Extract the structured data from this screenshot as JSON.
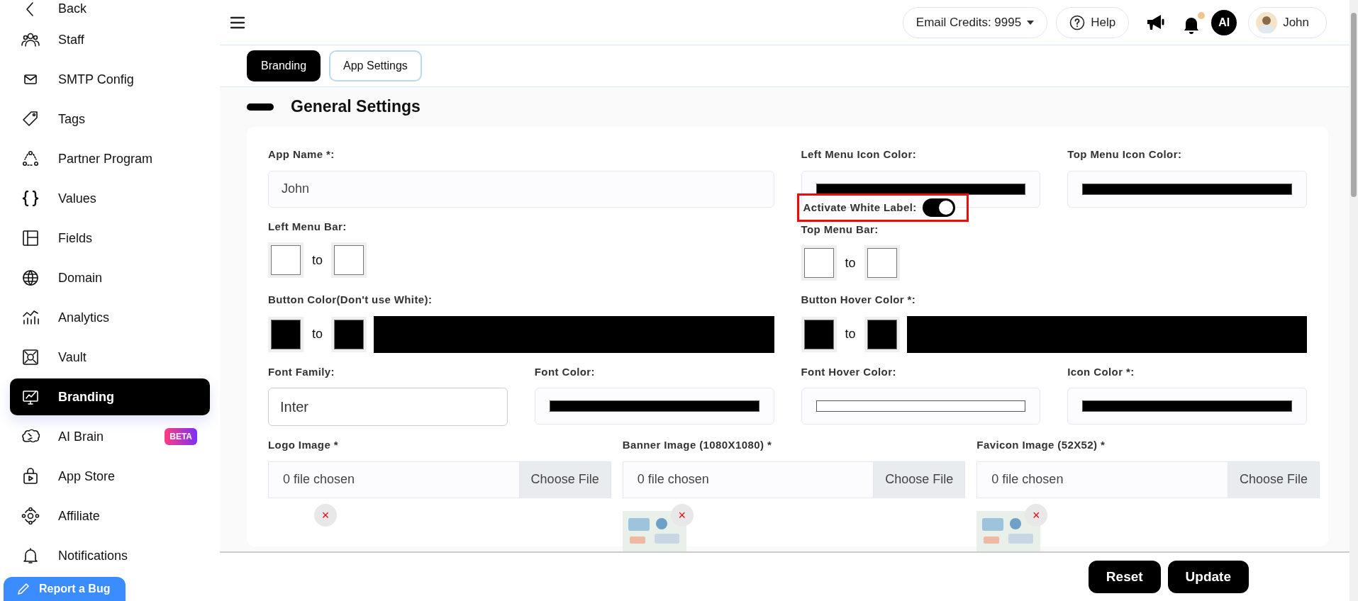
{
  "sidebar": {
    "items": [
      {
        "label": "Back",
        "selected": false
      },
      {
        "label": "Staff",
        "selected": false
      },
      {
        "label": "SMTP Config",
        "selected": false
      },
      {
        "label": "Tags",
        "selected": false
      },
      {
        "label": "Partner Program",
        "selected": false
      },
      {
        "label": "Values",
        "selected": false
      },
      {
        "label": "Fields",
        "selected": false
      },
      {
        "label": "Domain",
        "selected": false
      },
      {
        "label": "Analytics",
        "selected": false
      },
      {
        "label": "Vault",
        "selected": false
      },
      {
        "label": "Branding",
        "selected": true
      },
      {
        "label": "AI Brain",
        "selected": false,
        "badge": "BETA"
      },
      {
        "label": "App Store",
        "selected": false
      },
      {
        "label": "Affiliate",
        "selected": false
      },
      {
        "label": "Notifications",
        "selected": false
      }
    ],
    "report_button": "Report a Bug"
  },
  "topbar": {
    "credits": "Email Credits: 9995",
    "help": "Help",
    "notification_dot": true,
    "initials": "AI",
    "user": "John"
  },
  "tabs": [
    {
      "label": "Branding",
      "selected": true
    },
    {
      "label": "App Settings",
      "selected": false
    }
  ],
  "section_title": "General Settings",
  "white_label": {
    "label": "Activate White Label:",
    "on": true,
    "highlighted": true
  },
  "rows": [
    [
      {
        "kind": "text",
        "label": "App Name *:",
        "value": "John"
      },
      {
        "kind": "color",
        "label": "Left Menu Icon Color:",
        "color": "#000000"
      },
      {
        "kind": "color",
        "label": "Top Menu Icon Color:",
        "color": "#000000"
      }
    ],
    [
      {
        "kind": "pair",
        "label": "Left Menu Bar:",
        "swatches": [
          {
            "color": "#ffffff"
          },
          {
            "color": "#ffffff"
          }
        ],
        "to_text": "to"
      },
      {
        "kind": "pair",
        "label": "Top Menu Bar:",
        "swatches": [
          {
            "color": "#ffffff"
          },
          {
            "color": "#ffffff"
          }
        ],
        "to_text": "to"
      }
    ],
    [
      {
        "kind": "gradient",
        "label": "Button Color(Don't use White):",
        "swatches": [
          {
            "color": "#000000"
          },
          {
            "color": "#000000"
          }
        ],
        "to_text": "to",
        "color": "#000000"
      },
      {
        "kind": "gradient",
        "label": "Button Hover Color *:",
        "swatches": [
          {
            "color": "#000000"
          },
          {
            "color": "#000000"
          }
        ],
        "to_text": "to",
        "color": "#000000"
      }
    ],
    [
      {
        "kind": "select",
        "label": "Font Family:",
        "value": "Inter"
      },
      {
        "kind": "color",
        "label": "Font Color:",
        "color": "#000000"
      },
      {
        "kind": "color",
        "label": "Font Hover Color:",
        "color": "#ffffff"
      },
      {
        "kind": "color",
        "label": "Icon Color *:",
        "color": "#000000"
      }
    ]
  ],
  "uploads": [
    {
      "label": "Logo Image *",
      "file_text": "0 file chosen",
      "button": "Choose File",
      "preview": false,
      "remove": "×"
    },
    {
      "label": "Banner Image (1080X1080) *",
      "file_text": "0 file chosen",
      "button": "Choose File",
      "preview": true,
      "remove": "×"
    },
    {
      "label": "Favicon Image (52X52) *",
      "file_text": "0 file chosen",
      "button": "Choose File",
      "preview": true,
      "remove": "×"
    }
  ],
  "footer": {
    "buttons": [
      "Reset",
      "Update"
    ]
  }
}
